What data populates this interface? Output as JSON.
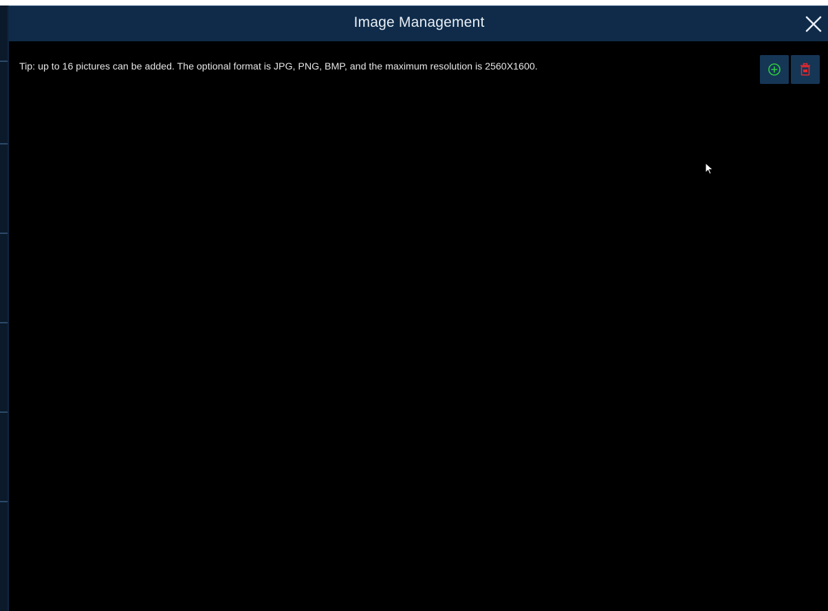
{
  "dialog": {
    "title": "Image Management",
    "tip": "Tip: up to 16 pictures can be added. The optional format is JPG, PNG, BMP, and the maximum resolution is 2560X1600.",
    "toolbar": {
      "add_icon": "add-circle-icon",
      "delete_icon": "trash-icon"
    },
    "close_icon": "close-icon"
  },
  "colors": {
    "titlebar": "#0f2b49",
    "body": "#000000",
    "add_accent": "#2ecc40",
    "delete_accent": "#e0282e"
  }
}
